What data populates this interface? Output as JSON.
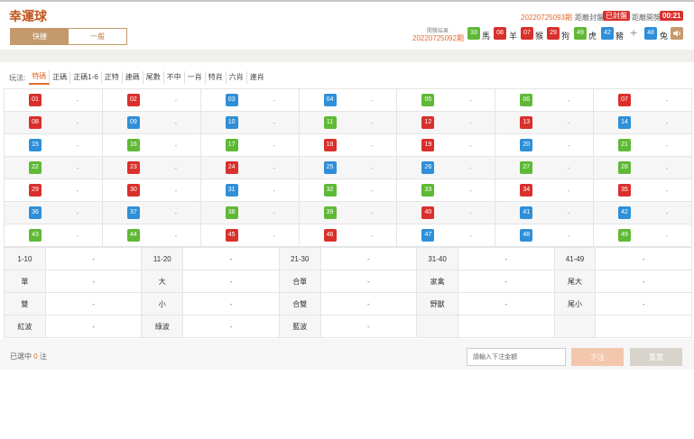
{
  "header": {
    "title": "幸運球",
    "tabs": [
      {
        "label": "快捷"
      },
      {
        "label": "一般"
      }
    ],
    "current_issue": "20220725093期",
    "close_label": "距離封盤",
    "closed_badge": "已封盤",
    "open_label": "距離開獎",
    "countdown": "00:21",
    "result_label": "開獎結果",
    "prev_issue": "20220725092期",
    "results": [
      {
        "number": "33",
        "color": "green",
        "zodiac": "馬"
      },
      {
        "number": "08",
        "color": "red",
        "zodiac": "羊"
      },
      {
        "number": "07",
        "color": "red",
        "zodiac": "猴"
      },
      {
        "number": "29",
        "color": "red",
        "zodiac": "狗"
      },
      {
        "number": "49",
        "color": "green",
        "zodiac": "虎"
      },
      {
        "number": "42",
        "color": "blue",
        "zodiac": "豬"
      }
    ],
    "plus": "+",
    "special": {
      "number": "48",
      "color": "blue",
      "zodiac": "兔"
    }
  },
  "play": {
    "label": "玩法:",
    "tabs": [
      "特碼",
      "正碼",
      "正碼1-6",
      "正特",
      "連碼",
      "尾數",
      "不中",
      "一肖",
      "特肖",
      "六肖",
      "連肖"
    ]
  },
  "numbers": [
    {
      "n": "01",
      "c": "red",
      "odds": "-"
    },
    {
      "n": "02",
      "c": "red",
      "odds": "-"
    },
    {
      "n": "03",
      "c": "blue",
      "odds": "-"
    },
    {
      "n": "04",
      "c": "blue",
      "odds": "-"
    },
    {
      "n": "05",
      "c": "green",
      "odds": "-"
    },
    {
      "n": "06",
      "c": "green",
      "odds": "-"
    },
    {
      "n": "07",
      "c": "red",
      "odds": "-"
    },
    {
      "n": "08",
      "c": "red",
      "odds": "-"
    },
    {
      "n": "09",
      "c": "blue",
      "odds": "-"
    },
    {
      "n": "10",
      "c": "blue",
      "odds": "-"
    },
    {
      "n": "11",
      "c": "green",
      "odds": "-"
    },
    {
      "n": "12",
      "c": "red",
      "odds": "-"
    },
    {
      "n": "13",
      "c": "red",
      "odds": "-"
    },
    {
      "n": "14",
      "c": "blue",
      "odds": "-"
    },
    {
      "n": "15",
      "c": "blue",
      "odds": "-"
    },
    {
      "n": "16",
      "c": "green",
      "odds": "-"
    },
    {
      "n": "17",
      "c": "green",
      "odds": "-"
    },
    {
      "n": "18",
      "c": "red",
      "odds": "-"
    },
    {
      "n": "19",
      "c": "red",
      "odds": "-"
    },
    {
      "n": "20",
      "c": "blue",
      "odds": "-"
    },
    {
      "n": "21",
      "c": "green",
      "odds": "-"
    },
    {
      "n": "22",
      "c": "green",
      "odds": "-"
    },
    {
      "n": "23",
      "c": "red",
      "odds": "-"
    },
    {
      "n": "24",
      "c": "red",
      "odds": "-"
    },
    {
      "n": "25",
      "c": "blue",
      "odds": "-"
    },
    {
      "n": "26",
      "c": "blue",
      "odds": "-"
    },
    {
      "n": "27",
      "c": "green",
      "odds": "-"
    },
    {
      "n": "28",
      "c": "green",
      "odds": "-"
    },
    {
      "n": "29",
      "c": "red",
      "odds": "-"
    },
    {
      "n": "30",
      "c": "red",
      "odds": "-"
    },
    {
      "n": "31",
      "c": "blue",
      "odds": "-"
    },
    {
      "n": "32",
      "c": "green",
      "odds": "-"
    },
    {
      "n": "33",
      "c": "green",
      "odds": "-"
    },
    {
      "n": "34",
      "c": "red",
      "odds": "-"
    },
    {
      "n": "35",
      "c": "red",
      "odds": "-"
    },
    {
      "n": "36",
      "c": "blue",
      "odds": "-"
    },
    {
      "n": "37",
      "c": "blue",
      "odds": "-"
    },
    {
      "n": "38",
      "c": "green",
      "odds": "-"
    },
    {
      "n": "39",
      "c": "green",
      "odds": "-"
    },
    {
      "n": "40",
      "c": "red",
      "odds": "-"
    },
    {
      "n": "41",
      "c": "blue",
      "odds": "-"
    },
    {
      "n": "42",
      "c": "blue",
      "odds": "-"
    },
    {
      "n": "43",
      "c": "green",
      "odds": "-"
    },
    {
      "n": "44",
      "c": "green",
      "odds": "-"
    },
    {
      "n": "45",
      "c": "red",
      "odds": "-"
    },
    {
      "n": "46",
      "c": "red",
      "odds": "-"
    },
    {
      "n": "47",
      "c": "blue",
      "odds": "-"
    },
    {
      "n": "48",
      "c": "blue",
      "odds": "-"
    },
    {
      "n": "49",
      "c": "green",
      "odds": "-"
    }
  ],
  "attributes": [
    [
      {
        "k": "1-10",
        "v": "-"
      },
      {
        "k": "11-20",
        "v": "-"
      },
      {
        "k": "21-30",
        "v": "-"
      },
      {
        "k": "31-40",
        "v": "-"
      },
      {
        "k": "41-49",
        "v": "-"
      }
    ],
    [
      {
        "k": "單",
        "v": "-"
      },
      {
        "k": "大",
        "v": "-"
      },
      {
        "k": "合單",
        "v": "-"
      },
      {
        "k": "家禽",
        "v": "-"
      },
      {
        "k": "尾大",
        "v": "-"
      }
    ],
    [
      {
        "k": "雙",
        "v": "-"
      },
      {
        "k": "小",
        "v": "-"
      },
      {
        "k": "合雙",
        "v": "-"
      },
      {
        "k": "野獸",
        "v": "-"
      },
      {
        "k": "尾小",
        "v": "-"
      }
    ],
    [
      {
        "k": "紅波",
        "v": "-"
      },
      {
        "k": "綠波",
        "v": "-"
      },
      {
        "k": "藍波",
        "v": "-"
      },
      {
        "k": "",
        "v": ""
      },
      {
        "k": "",
        "v": ""
      }
    ]
  ],
  "footer": {
    "selected_prefix": "已選中",
    "selected_count": "0",
    "selected_suffix": "注",
    "amount_placeholder": "請輸入下注金額",
    "submit_label": "下注",
    "reset_label": "重置"
  },
  "colors": {
    "red": "#d9302c",
    "blue": "#2f8fd8",
    "green": "#5fb936",
    "accent": "#e06a2a",
    "tab_active": "#c49a6c"
  }
}
